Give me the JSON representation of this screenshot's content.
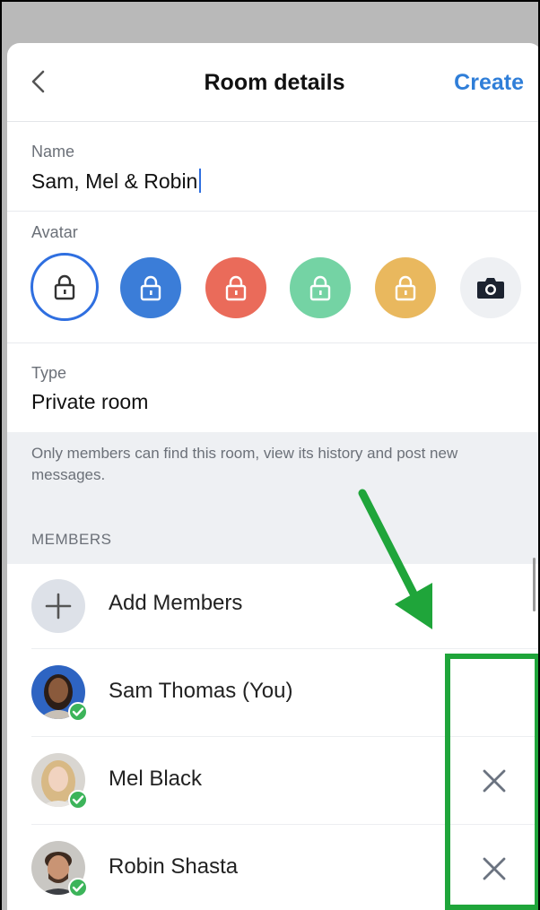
{
  "header": {
    "title": "Room details",
    "create_label": "Create",
    "back_icon": "chevron-left-icon"
  },
  "name_field": {
    "label": "Name",
    "value": "Sam, Mel & Robin"
  },
  "avatar": {
    "label": "Avatar",
    "options": [
      {
        "name": "avatar-option-outline",
        "color": "#ffffff",
        "selected": true
      },
      {
        "name": "avatar-option-blue",
        "color": "#3b7dd8"
      },
      {
        "name": "avatar-option-red",
        "color": "#ea6b5a"
      },
      {
        "name": "avatar-option-green",
        "color": "#74d3a4"
      },
      {
        "name": "avatar-option-yellow",
        "color": "#e9b85e"
      },
      {
        "name": "avatar-option-camera",
        "color": "#eef0f3"
      }
    ]
  },
  "type_field": {
    "label": "Type",
    "value": "Private room"
  },
  "info": {
    "text": "Only members can find this room, view its history and post new messages.",
    "members_label": "MEMBERS"
  },
  "members": {
    "add_label": "Add Members",
    "list": [
      {
        "name": "Sam Thomas (You)",
        "removable": false
      },
      {
        "name": "Mel Black",
        "removable": true
      },
      {
        "name": "Robin Shasta",
        "removable": true
      }
    ]
  },
  "colors": {
    "accent": "#2f7ed8",
    "annotation": "#1fa53a",
    "status_online": "#3cb45a"
  }
}
